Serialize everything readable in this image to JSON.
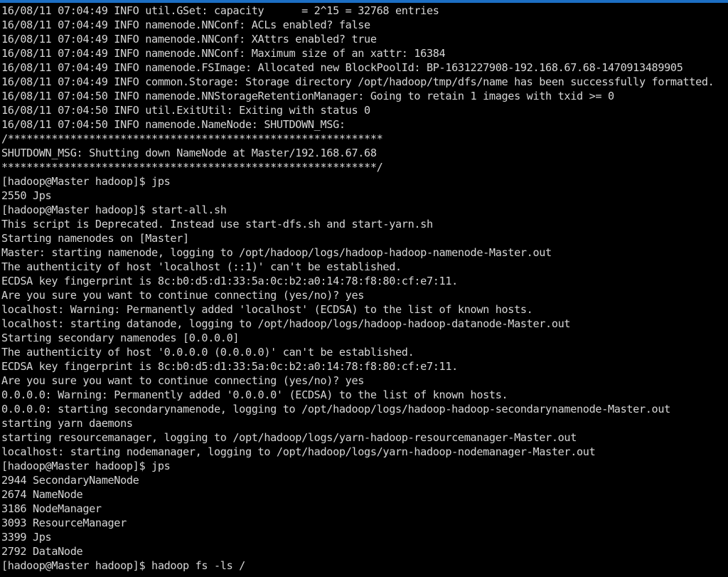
{
  "window": {
    "type": "terminal-emulator",
    "accent_color": "#1c6fc4",
    "background_color": "#000000",
    "foreground_color": "#d6d6d6",
    "prompt": "[hadoop@Master hadoop]$",
    "hostname": "Master",
    "user": "hadoop",
    "cwd_label": "hadoop"
  },
  "terminal": {
    "lines": [
      "16/08/11 07:04:49 INFO util.GSet: capacity      = 2^15 = 32768 entries",
      "16/08/11 07:04:49 INFO namenode.NNConf: ACLs enabled? false",
      "16/08/11 07:04:49 INFO namenode.NNConf: XAttrs enabled? true",
      "16/08/11 07:04:49 INFO namenode.NNConf: Maximum size of an xattr: 16384",
      "16/08/11 07:04:49 INFO namenode.FSImage: Allocated new BlockPoolId: BP-1631227908-192.168.67.68-1470913489905",
      "16/08/11 07:04:49 INFO common.Storage: Storage directory /opt/hadoop/tmp/dfs/name has been successfully formatted.",
      "16/08/11 07:04:50 INFO namenode.NNStorageRetentionManager: Going to retain 1 images with txid >= 0",
      "16/08/11 07:04:50 INFO util.ExitUtil: Exiting with status 0",
      "16/08/11 07:04:50 INFO namenode.NameNode: SHUTDOWN_MSG:",
      "/************************************************************",
      "SHUTDOWN_MSG: Shutting down NameNode at Master/192.168.67.68",
      "************************************************************/",
      "[hadoop@Master hadoop]$ jps",
      "2550 Jps",
      "[hadoop@Master hadoop]$ start-all.sh",
      "This script is Deprecated. Instead use start-dfs.sh and start-yarn.sh",
      "Starting namenodes on [Master]",
      "Master: starting namenode, logging to /opt/hadoop/logs/hadoop-hadoop-namenode-Master.out",
      "The authenticity of host 'localhost (::1)' can't be established.",
      "ECDSA key fingerprint is 8c:b0:d5:d1:33:5a:0c:b2:a0:14:78:f8:80:cf:e7:11.",
      "Are you sure you want to continue connecting (yes/no)? yes",
      "localhost: Warning: Permanently added 'localhost' (ECDSA) to the list of known hosts.",
      "localhost: starting datanode, logging to /opt/hadoop/logs/hadoop-hadoop-datanode-Master.out",
      "Starting secondary namenodes [0.0.0.0]",
      "The authenticity of host '0.0.0.0 (0.0.0.0)' can't be established.",
      "ECDSA key fingerprint is 8c:b0:d5:d1:33:5a:0c:b2:a0:14:78:f8:80:cf:e7:11.",
      "Are you sure you want to continue connecting (yes/no)? yes",
      "0.0.0.0: Warning: Permanently added '0.0.0.0' (ECDSA) to the list of known hosts.",
      "0.0.0.0: starting secondarynamenode, logging to /opt/hadoop/logs/hadoop-hadoop-secondarynamenode-Master.out",
      "starting yarn daemons",
      "starting resourcemanager, logging to /opt/hadoop/logs/yarn-hadoop-resourcemanager-Master.out",
      "localhost: starting nodemanager, logging to /opt/hadoop/logs/yarn-hadoop-nodemanager-Master.out",
      "[hadoop@Master hadoop]$ jps",
      "2944 SecondaryNameNode",
      "2674 NameNode",
      "3186 NodeManager",
      "3093 ResourceManager",
      "3399 Jps",
      "2792 DataNode",
      "[hadoop@Master hadoop]$ hadoop fs -ls /"
    ],
    "commands_entered": [
      "jps",
      "start-all.sh",
      "jps",
      "hadoop fs -ls /"
    ],
    "jps_processes": [
      {
        "pid": "2944",
        "name": "SecondaryNameNode"
      },
      {
        "pid": "2674",
        "name": "NameNode"
      },
      {
        "pid": "3186",
        "name": "NodeManager"
      },
      {
        "pid": "3093",
        "name": "ResourceManager"
      },
      {
        "pid": "3399",
        "name": "Jps"
      },
      {
        "pid": "2792",
        "name": "DataNode"
      }
    ]
  }
}
